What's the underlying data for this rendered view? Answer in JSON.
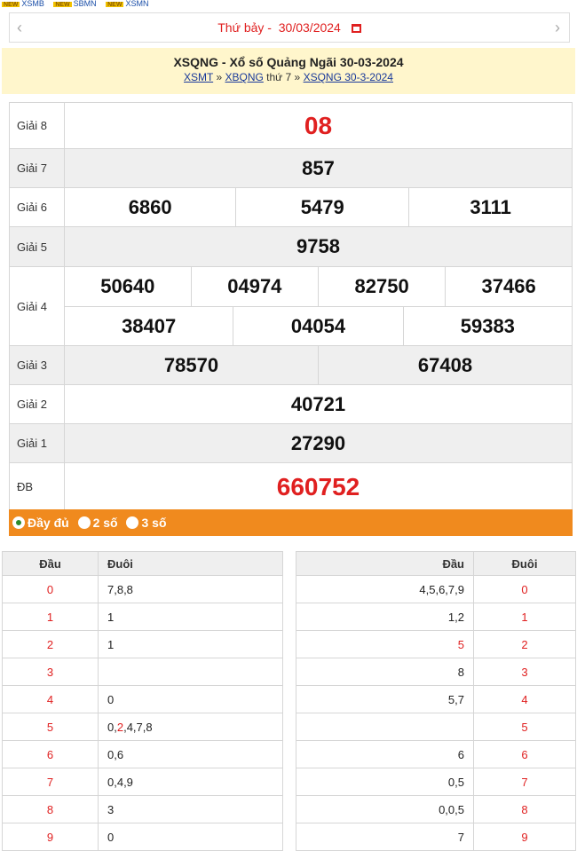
{
  "top_links": [
    {
      "tag": "xsmb",
      "label": "XSMB"
    },
    {
      "tag": "xsmn",
      "label": "SBMN"
    },
    {
      "tag": "xsmt",
      "label": "XSMN"
    }
  ],
  "date_nav": {
    "weekday": "Thứ bảy -",
    "date": "30/03/2024",
    "prev_icon": "‹",
    "next_icon": "›"
  },
  "header": {
    "title": "XSQNG - Xổ số Quảng Ngãi 30-03-2024",
    "crumb_1": "XSMT",
    "sep_1": " » ",
    "crumb_2": "XBQNG",
    "crumb_mid": " thứ 7 » ",
    "crumb_3": "XSQNG 30-3-2024"
  },
  "results": {
    "g8": {
      "label": "Giải 8",
      "value": "08"
    },
    "g7": {
      "label": "Giải 7",
      "value": "857"
    },
    "g6": {
      "label": "Giải 6",
      "values": [
        "6860",
        "5479",
        "3111"
      ]
    },
    "g5": {
      "label": "Giải 5",
      "value": "9758"
    },
    "g4": {
      "label": "Giải 4",
      "row1": [
        "50640",
        "04974",
        "82750",
        "37466"
      ],
      "row2": [
        "38407",
        "04054",
        "59383"
      ]
    },
    "g3": {
      "label": "Giải 3",
      "values": [
        "78570",
        "67408"
      ]
    },
    "g2": {
      "label": "Giải 2",
      "value": "40721"
    },
    "g1": {
      "label": "Giải 1",
      "value": "27290"
    },
    "db": {
      "label": "ĐB",
      "value": "660752"
    }
  },
  "filter": {
    "options": [
      "Đầy đủ",
      "2 số",
      "3 số"
    ],
    "selected": 0
  },
  "loto_left": {
    "head_label": "Đầu",
    "tail_label": "Đuôi",
    "rows": [
      {
        "head": "0",
        "tails": "7,8,8"
      },
      {
        "head": "1",
        "tails": "1"
      },
      {
        "head": "2",
        "tails": "1"
      },
      {
        "head": "3",
        "tails": ""
      },
      {
        "head": "4",
        "tails": "0"
      },
      {
        "head": "5",
        "tails_pre": "0,",
        "tails_red": "2",
        "tails_post": ",4,7,8"
      },
      {
        "head": "6",
        "tails": "0,6"
      },
      {
        "head": "7",
        "tails": "0,4,9"
      },
      {
        "head": "8",
        "tails": "3"
      },
      {
        "head": "9",
        "tails": "0"
      }
    ]
  },
  "loto_right": {
    "head_label": "Đầu",
    "tail_label": "Đuôi",
    "rows": [
      {
        "heads": "4,5,6,7,9",
        "tail": "0"
      },
      {
        "heads": "1,2",
        "tail": "1"
      },
      {
        "heads": "5",
        "heads_red": true,
        "tail": "2"
      },
      {
        "heads": "8",
        "tail": "3"
      },
      {
        "heads": "5,7",
        "tail": "4"
      },
      {
        "heads": "",
        "tail": "5"
      },
      {
        "heads": "6",
        "tail": "6"
      },
      {
        "heads": "0,5",
        "tail": "7"
      },
      {
        "heads": "0,0,5",
        "tail": "8"
      },
      {
        "heads": "7",
        "tail": "9"
      }
    ]
  },
  "colors": {
    "accent_red": "#e02020",
    "orange_bar": "#f08a1e",
    "header_bg": "#fff6cc"
  }
}
